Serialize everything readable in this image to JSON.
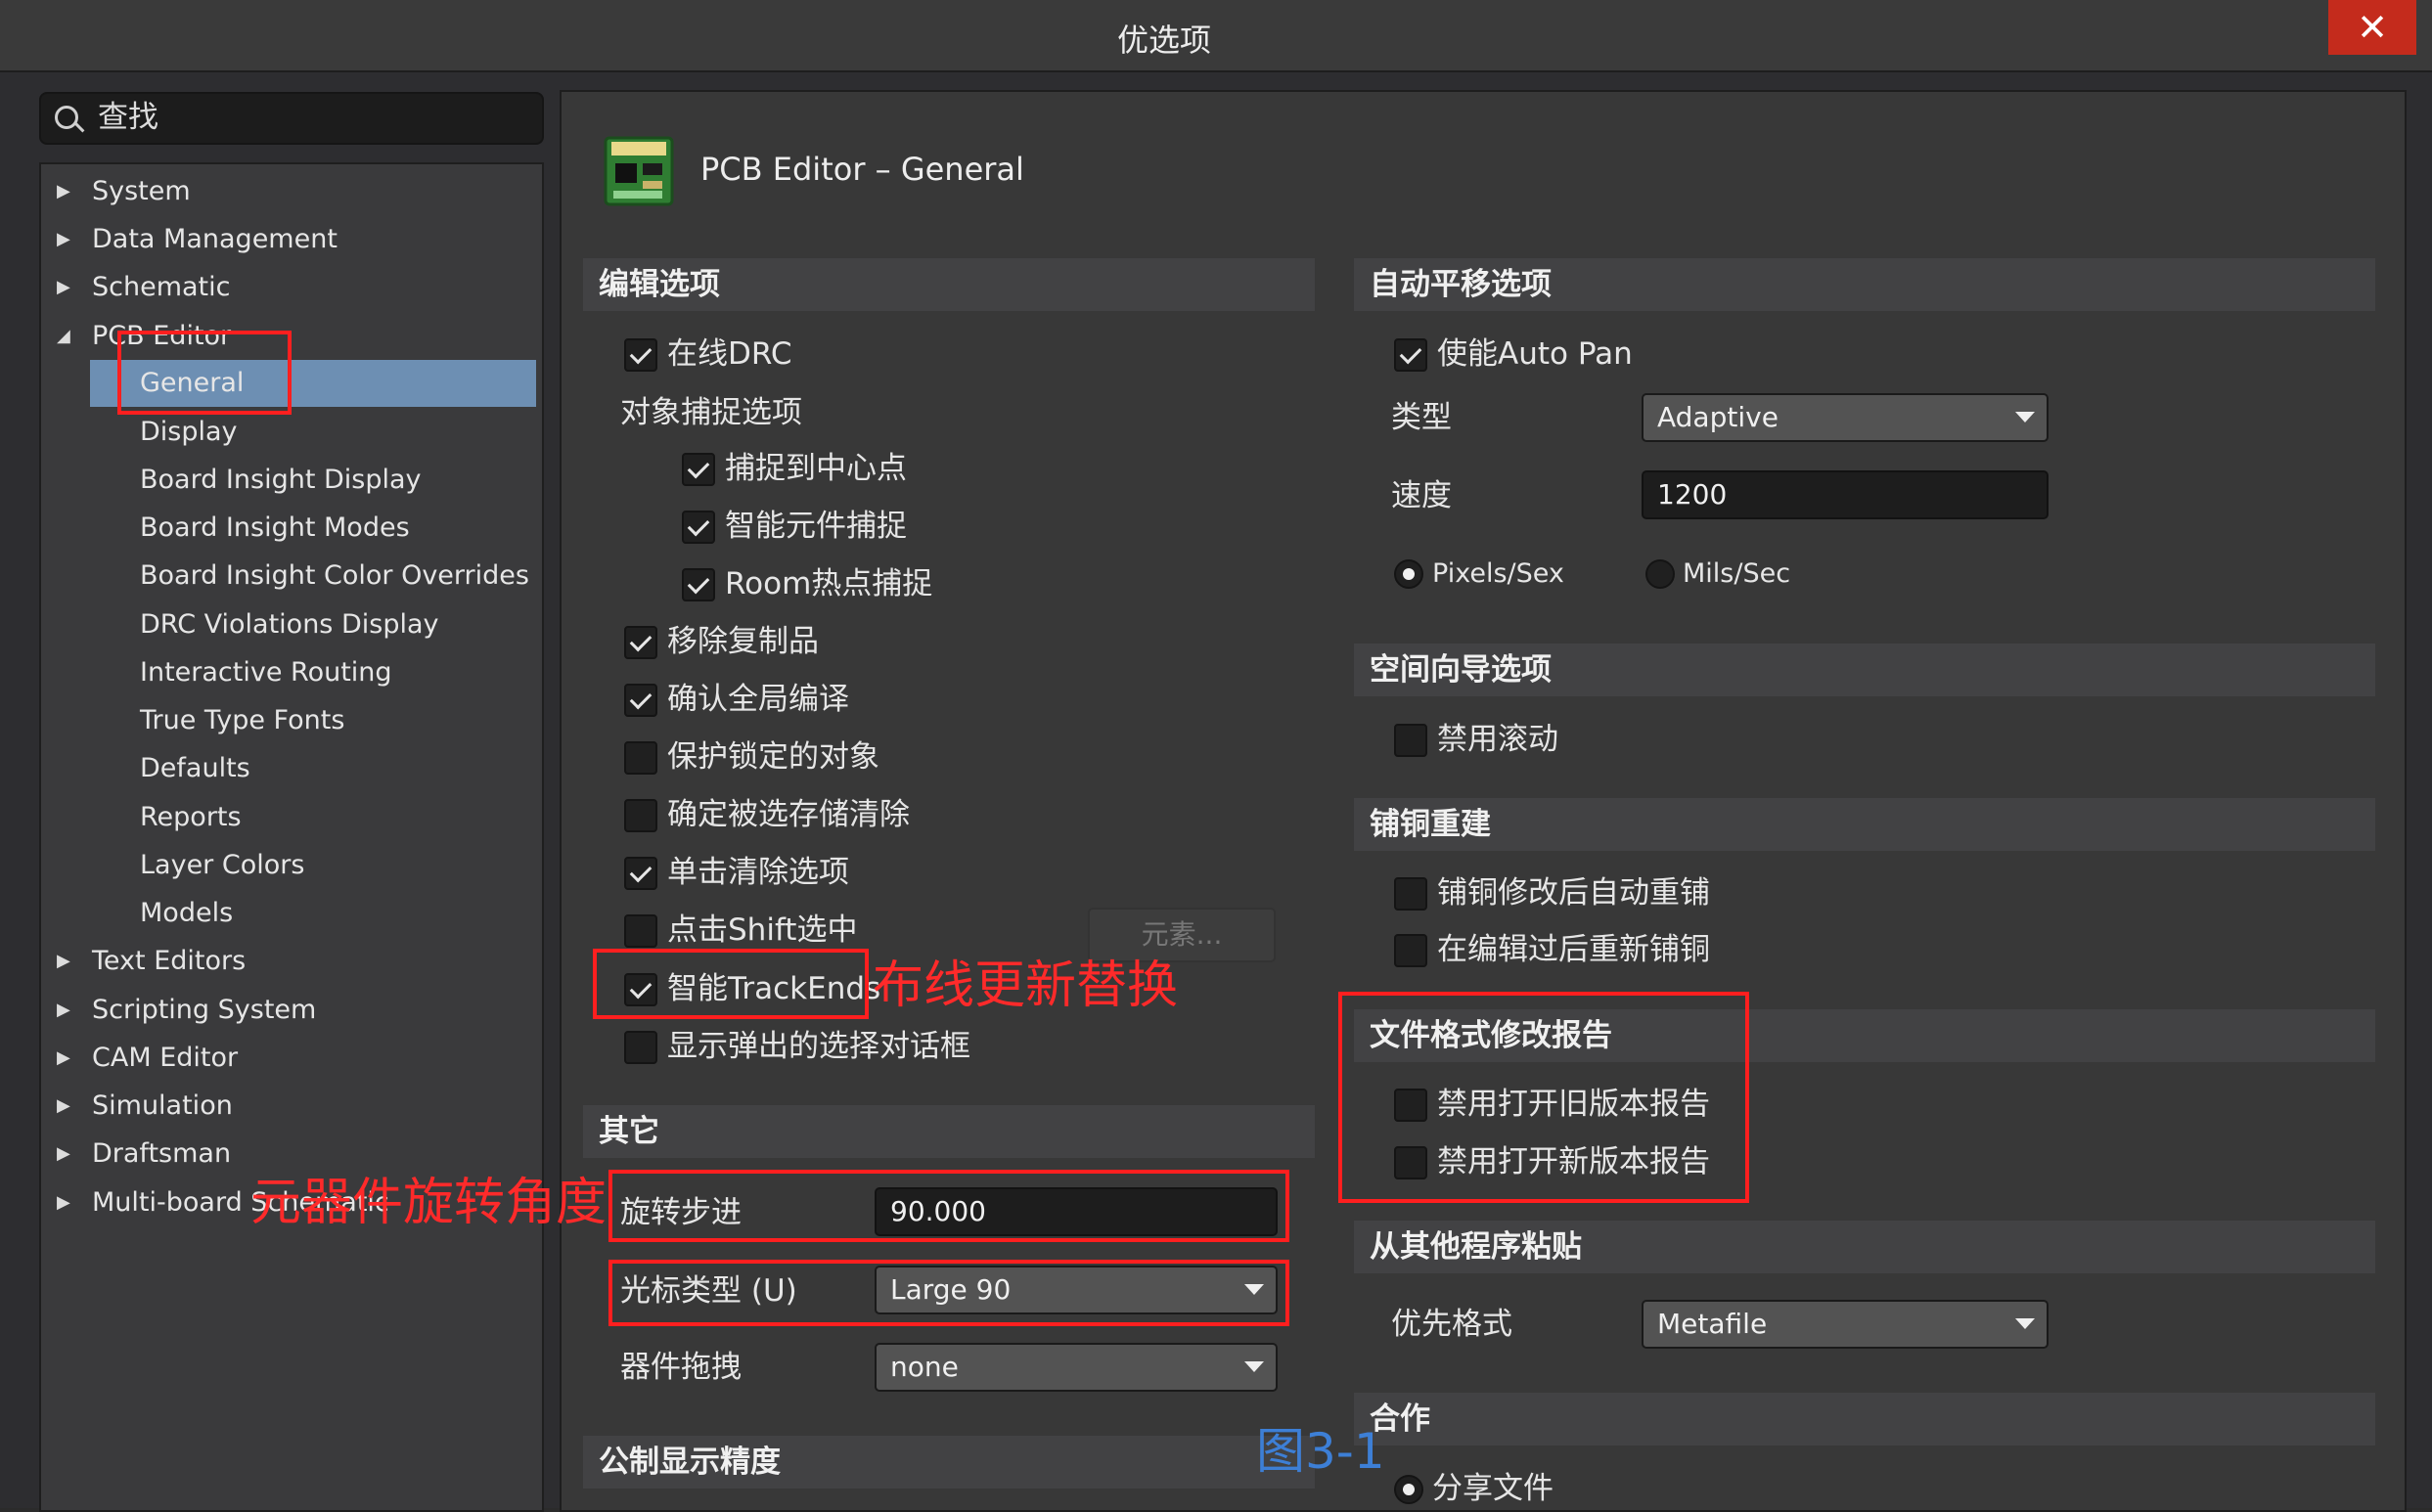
{
  "window": {
    "title": "优选项",
    "close_label": "✕"
  },
  "search": {
    "placeholder": "查找"
  },
  "tree": {
    "top": [
      {
        "label": "System",
        "arrow": "▶"
      },
      {
        "label": "Data Management",
        "arrow": "▶"
      },
      {
        "label": "Schematic",
        "arrow": "▶"
      },
      {
        "label": "PCB Editor",
        "arrow": "◢"
      }
    ],
    "pcb_children": [
      "General",
      "Display",
      "Board Insight Display",
      "Board Insight Modes",
      "Board Insight Color Overrides",
      "DRC Violations Display",
      "Interactive Routing",
      "True Type Fonts",
      "Defaults",
      "Reports",
      "Layer Colors",
      "Models"
    ],
    "bottom": [
      {
        "label": "Text Editors",
        "arrow": "▶"
      },
      {
        "label": "Scripting System",
        "arrow": "▶"
      },
      {
        "label": "CAM Editor",
        "arrow": "▶"
      },
      {
        "label": "Simulation",
        "arrow": "▶"
      },
      {
        "label": "Draftsman",
        "arrow": "▶"
      },
      {
        "label": "Multi-board Schematic",
        "arrow": "▶"
      }
    ]
  },
  "page": {
    "title": "PCB Editor – General"
  },
  "edit": {
    "header": "编辑选项",
    "online_drc": "在线DRC",
    "snap_header": "对象捕捉选项",
    "snap_center": "捕捉到中心点",
    "smart_component": "智能元件捕捉",
    "room_hotspot": "Room热点捕捉",
    "remove_duplicates": "移除复制品",
    "confirm_global": "确认全局编译",
    "protect_locked": "保护锁定的对象",
    "confirm_clear": "确定被选存储清除",
    "click_clear": "单击清除选项",
    "shift_select": "点击Shift选中",
    "elements_btn": "元素...",
    "smart_trackends": "智能TrackEnds",
    "show_popup": "显示弹出的选择对话框"
  },
  "other": {
    "header": "其它",
    "rotation_label": "旋转步进",
    "rotation_value": "90.000",
    "cursor_label": "光标类型 (U)",
    "cursor_value": "Large 90",
    "drag_label": "器件拖拽",
    "drag_value": "none"
  },
  "metric": {
    "header": "公制显示精度"
  },
  "autopan": {
    "header": "自动平移选项",
    "enable": "使能Auto Pan",
    "type_label": "类型",
    "type_value": "Adaptive",
    "speed_label": "速度",
    "speed_value": "1200",
    "pixels": "Pixels/Sex",
    "mils": "Mils/Sec"
  },
  "spacenav": {
    "header": "空间向导选项",
    "disable_roll": "禁用滚动"
  },
  "polygon": {
    "header": "铺铜重建",
    "auto_repour": "铺铜修改后自动重铺",
    "repour_after_edit": "在编辑过后重新铺铜"
  },
  "fileformat": {
    "header": "文件格式修改报告",
    "disable_old": "禁用打开旧版本报告",
    "disable_new": "禁用打开新版本报告"
  },
  "paste": {
    "header": "从其他程序粘贴",
    "format_label": "优先格式",
    "format_value": "Metafile"
  },
  "collab": {
    "header": "合作",
    "share": "分享文件"
  },
  "annotations": {
    "routing": "布线更新替换",
    "rotation": "元器件旋转角度",
    "figure": "图3-1"
  }
}
